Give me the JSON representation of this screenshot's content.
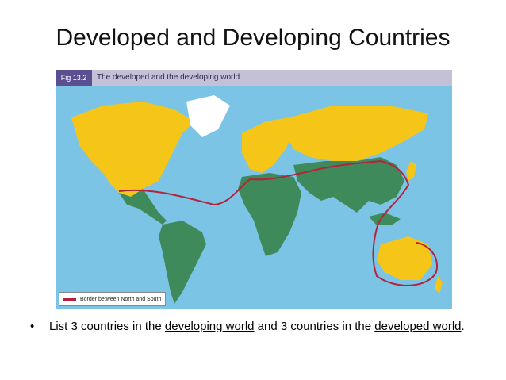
{
  "slide": {
    "title": "Developed and Developing Countries"
  },
  "figure": {
    "number": "Fig 13.2",
    "title": "The developed and the developing world",
    "legend_label": "Border between North and South",
    "colors": {
      "ocean": "#7cc4e6",
      "developed": "#f5c518",
      "developing": "#3f8a5a",
      "border_line": "#b3243c",
      "header_band": "#c4c0d8",
      "fig_label_bg": "#5b4f92"
    }
  },
  "bullet": {
    "marker": "•",
    "part1": "List 3 countries in the ",
    "link1": "developing world",
    "part2": " and 3 countries in the ",
    "link2": "developed world",
    "part3": "."
  }
}
